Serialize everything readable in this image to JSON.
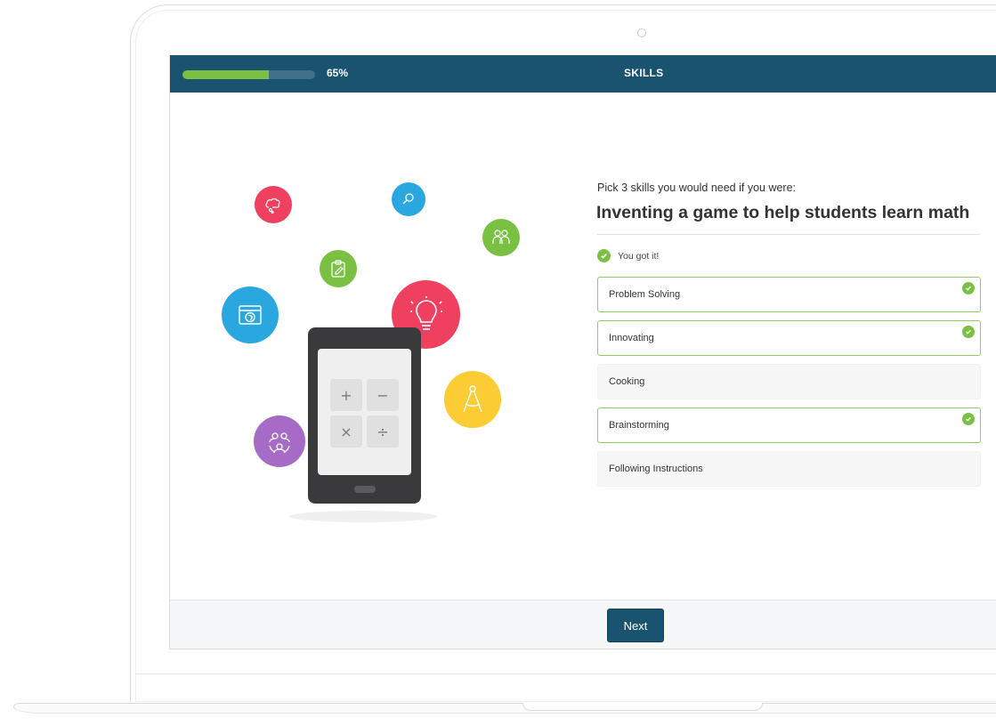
{
  "header": {
    "progress_percent": 65,
    "progress_label": "65%",
    "title": "SKILLS"
  },
  "question": {
    "prompt": "Pick 3 skills you would need if you were:",
    "title": "Inventing a game to help students learn math",
    "feedback": "You got it!"
  },
  "options": [
    {
      "label": "Problem Solving",
      "selected": true
    },
    {
      "label": "Innovating",
      "selected": true
    },
    {
      "label": "Cooking",
      "selected": false
    },
    {
      "label": "Brainstorming",
      "selected": true
    },
    {
      "label": "Following Instructions",
      "selected": false
    }
  ],
  "calculator_keys": [
    "+",
    "−",
    "×",
    "÷"
  ],
  "footer": {
    "next_label": "Next"
  },
  "colors": {
    "header_bg": "#1a5370",
    "progress_fill": "#7ac143",
    "correct_green": "#7ac143",
    "bubble_red": "#f0405f",
    "bubble_blue": "#2aa7de",
    "bubble_green": "#7ac143",
    "bubble_yellow": "#fbcc33",
    "bubble_purple": "#a56bc6"
  },
  "icons": [
    "brain-icon",
    "magnifier-icon",
    "people-group-icon",
    "clipboard-icon",
    "browser-globe-icon",
    "lightbulb-icon",
    "compass-icon",
    "people-circle-icon"
  ]
}
